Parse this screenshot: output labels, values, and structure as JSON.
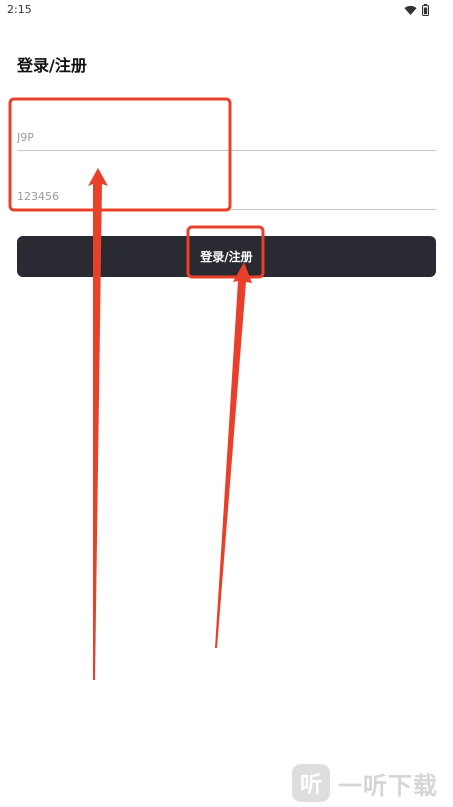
{
  "status_bar": {
    "time": "2:15",
    "icons": [
      "wifi-icon",
      "battery-icon"
    ]
  },
  "login": {
    "title": "登录/注册",
    "account_placeholder": "J9P",
    "password_placeholder": "123456",
    "submit_label": "登录/注册"
  },
  "annotations": {
    "highlight_color": "#e8402b"
  },
  "watermark": {
    "logo_char": "听",
    "text": "一听下载"
  }
}
